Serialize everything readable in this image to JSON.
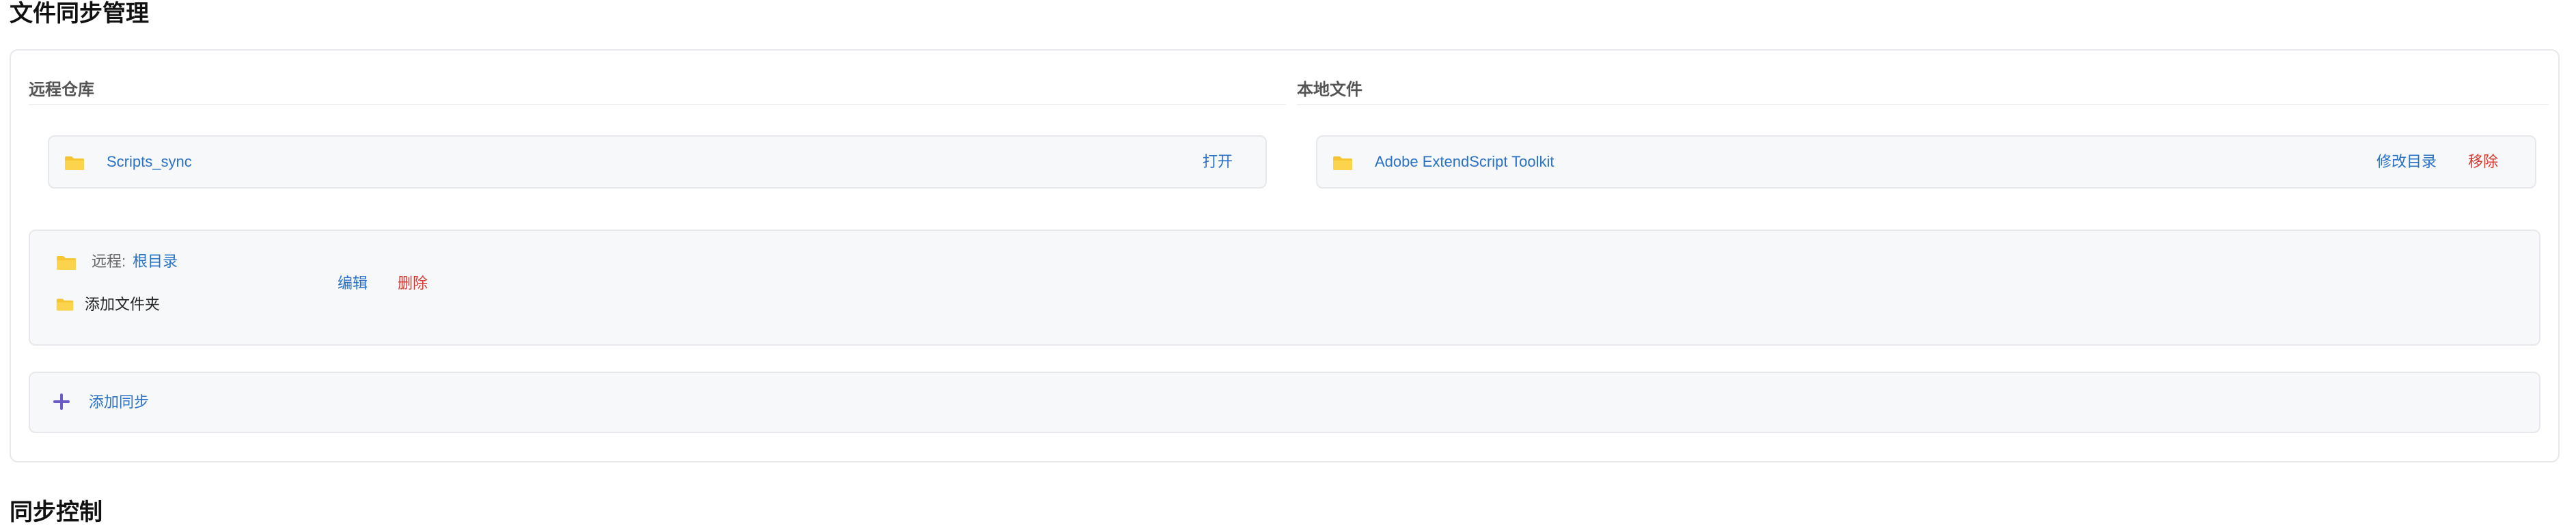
{
  "page": {
    "title": "文件同步管理",
    "next_section_title": "同步控制"
  },
  "remote_panel": {
    "header": "远程仓库",
    "repo_name": "Scripts_sync",
    "open_label": "打开"
  },
  "local_panel": {
    "header": "本地文件",
    "folder_name": "Adobe ExtendScript Toolkit",
    "modify_label": "修改目录",
    "remove_label": "移除"
  },
  "mapping": {
    "remote_prefix": "远程:",
    "remote_path": "根目录",
    "add_folder_label": "添加文件夹",
    "edit_label": "编辑",
    "delete_label": "删除"
  },
  "add_sync": {
    "label": "添加同步"
  },
  "colors": {
    "link": "#2a72c7",
    "danger": "#d63b32",
    "folder": "#f7c531",
    "plus": "#6b5bc9"
  },
  "icons": [
    "folder-icon",
    "plus-icon"
  ]
}
